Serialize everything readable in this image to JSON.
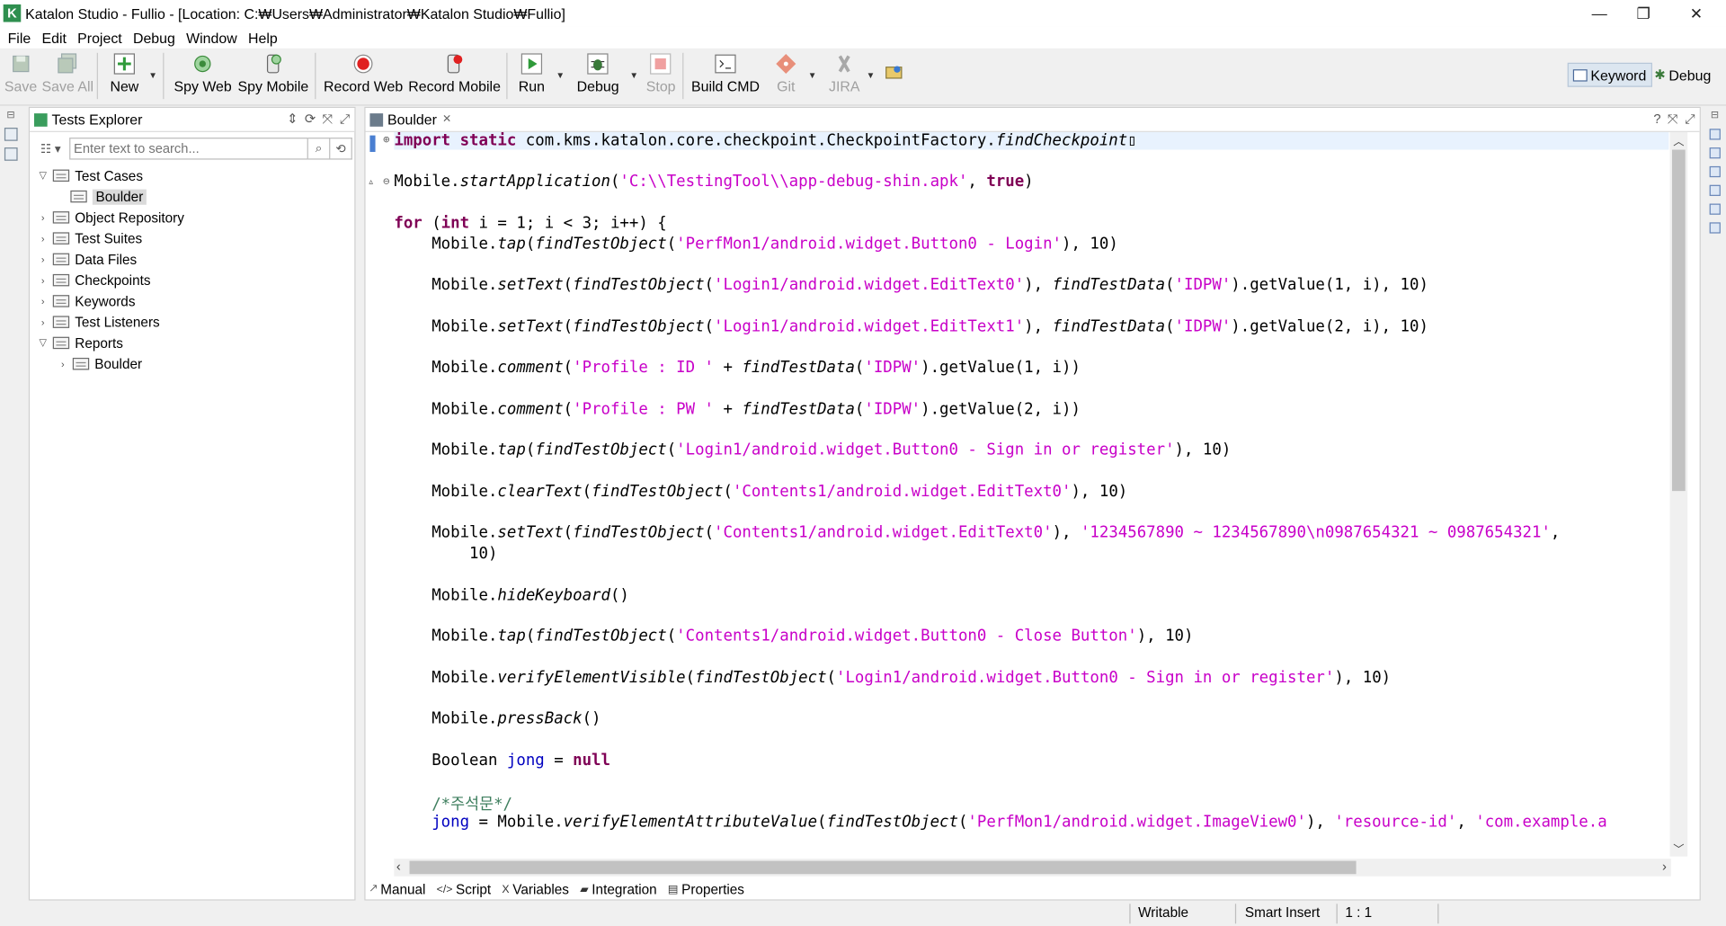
{
  "window": {
    "title": "Katalon Studio - Fullio - [Location: C:₩Users₩Administrator₩Katalon Studio₩Fullio]",
    "logo_letter": "K",
    "minimize": "—",
    "restore": "❐",
    "close": "✕"
  },
  "menu": [
    "File",
    "Edit",
    "Project",
    "Debug",
    "Window",
    "Help"
  ],
  "toolbar": {
    "save": "Save",
    "save_all": "Save All",
    "new": "New",
    "spy_web": "Spy Web",
    "spy_mobile": "Spy Mobile",
    "record_web": "Record Web",
    "record_mobile": "Record Mobile",
    "run": "Run",
    "debug": "Debug",
    "stop": "Stop",
    "build_cmd": "Build CMD",
    "git": "Git",
    "jira": "JIRA"
  },
  "perspectives": {
    "keyword": "Keyword",
    "debug": "Debug"
  },
  "explorer": {
    "tab_label": "Tests Explorer",
    "search_placeholder": "Enter text to search...",
    "tree": [
      {
        "label": "Test Cases",
        "expanded": true
      },
      {
        "label": "Boulder",
        "selected": true
      },
      {
        "label": "Object Repository"
      },
      {
        "label": "Test Suites"
      },
      {
        "label": "Data Files"
      },
      {
        "label": "Checkpoints"
      },
      {
        "label": "Keywords"
      },
      {
        "label": "Test Listeners"
      },
      {
        "label": "Reports",
        "expanded": true
      },
      {
        "label": "Boulder"
      }
    ]
  },
  "editor": {
    "tab_label": "Boulder",
    "code": {
      "l1_kw": "import static",
      "l1_rest": " com.kms.katalon.core.checkpoint.CheckpointFactory.",
      "l1_it": "findCheckpoint",
      "l2_a": "Mobile.",
      "l2_it": "startApplication",
      "l2_str": "'C:\\\\TestingTool\\\\app-debug-shin.apk'",
      "l2_kw": "true",
      "l3_for": "for",
      "l3_int": "int",
      "l3_rest": " i = 1; i < 3; i++) {",
      "tap": "tap",
      "setText": "setText",
      "comment": "comment",
      "clearText": "clearText",
      "hideKeyboard": "hideKeyboard",
      "verifyElementVisible": "verifyElementVisible",
      "pressBack": "pressBack",
      "verifyElementAttributeValue": "verifyElementAttributeValue",
      "findTestObject": "findTestObject",
      "findTestData": "findTestData",
      "s_login_btn": "'PerfMon1/android.widget.Button0 - Login'",
      "s_edit0": "'Login1/android.widget.EditText0'",
      "s_edit1": "'Login1/android.widget.EditText1'",
      "s_idpw": "'IDPW'",
      "s_profile_id": "'Profile : ID '",
      "s_profile_pw": "'Profile : PW '",
      "s_sign_in": "'Login1/android.widget.Button0 - Sign in or register'",
      "s_contents_edit": "'Contents1/android.widget.EditText0'",
      "s_numbers": "'1234567890 ~ 1234567890\\n0987654321 ~ 0987654321'",
      "s_close_btn": "'Contents1/android.widget.Button0 - Close Button'",
      "l_bool_type": "Boolean",
      "l_bool_var": "jong",
      "l_bool_null": "null",
      "l_comment": "/*주석문*/",
      "s_imageview": "'PerfMon1/android.widget.ImageView0'",
      "s_resource": "'resource-id'",
      "s_example": "'com.example.a"
    },
    "subtabs": [
      "Manual",
      "Script",
      "Variables",
      "Integration",
      "Properties"
    ]
  },
  "status": {
    "writable": "Writable",
    "insert_mode": "Smart Insert",
    "position": "1 : 1"
  },
  "colors": {
    "keyword": "#7f0055",
    "string": "#c800c8",
    "comment": "#3f7f5f",
    "record": "#e02020",
    "run": "#2f9a3a"
  }
}
